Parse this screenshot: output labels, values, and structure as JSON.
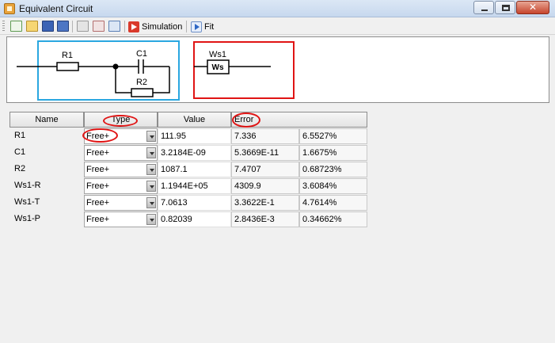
{
  "window": {
    "title": "Equivalent Circuit"
  },
  "toolbar": {
    "simulation_label": "Simulation",
    "fit_label": "Fit"
  },
  "circuit": {
    "labels": {
      "r1": "R1",
      "c1": "C1",
      "r2": "R2",
      "ws1": "Ws1",
      "ws_box": "Ws"
    },
    "colors": {
      "sub_circuit_frame": "#2aa7e0",
      "selected_frame": "#e01414"
    }
  },
  "table": {
    "headers": {
      "name": "Name",
      "type": "Type",
      "value": "Value",
      "error": "Error"
    },
    "rows": [
      {
        "name": "R1",
        "type": "Free+",
        "value": "111.95",
        "error": "7.336",
        "error_pct": "6.5527%"
      },
      {
        "name": "C1",
        "type": "Free+",
        "value": "3.2184E-09",
        "error": "5.3669E-11",
        "error_pct": "1.6675%"
      },
      {
        "name": "R2",
        "type": "Free+",
        "value": "1087.1",
        "error": "7.4707",
        "error_pct": "0.68723%"
      },
      {
        "name": "Ws1-R",
        "type": "Free+",
        "value": "1.1944E+05",
        "error": "4309.9",
        "error_pct": "3.6084%"
      },
      {
        "name": "Ws1-T",
        "type": "Free+",
        "value": "7.0613",
        "error": "3.3622E-1",
        "error_pct": "4.7614%"
      },
      {
        "name": "Ws1-P",
        "type": "Free+",
        "value": "0.82039",
        "error": "2.8436E-3",
        "error_pct": "0.34662%"
      }
    ]
  }
}
